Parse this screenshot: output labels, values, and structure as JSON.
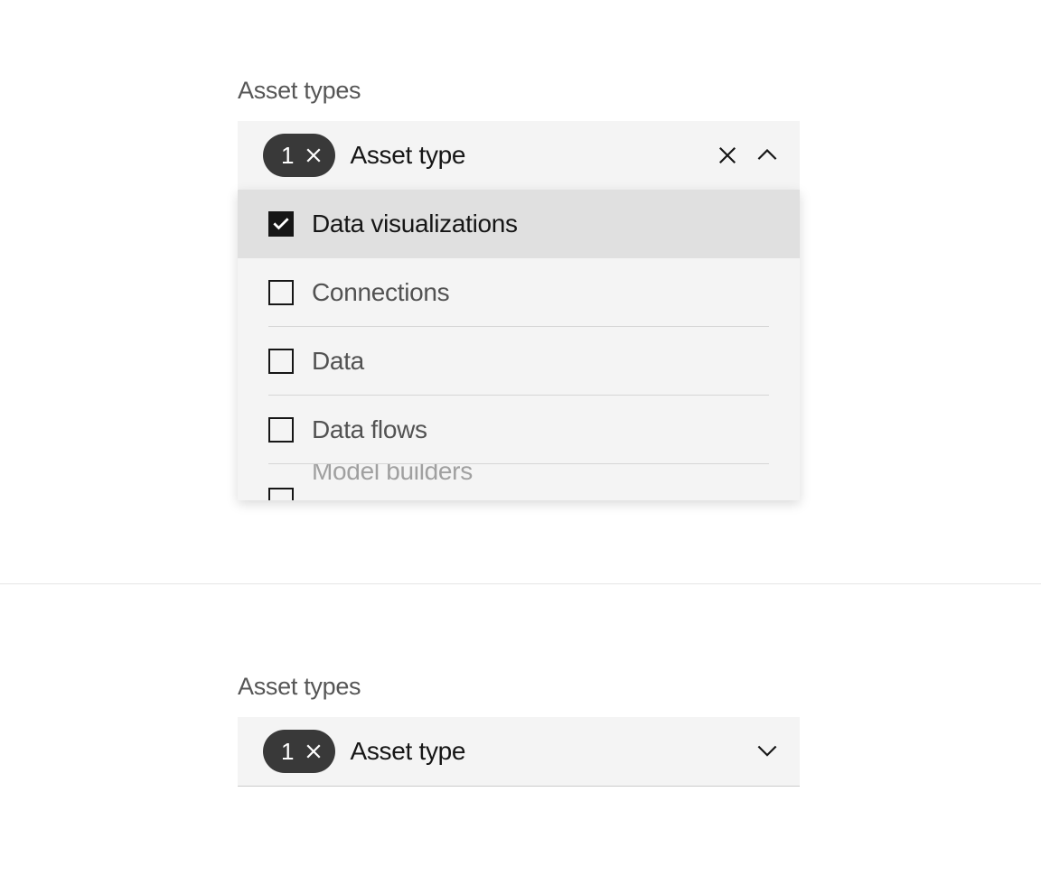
{
  "open_select": {
    "field_label": "Asset types",
    "count": "1",
    "title": "Asset type",
    "options": [
      {
        "label": "Data visualizations",
        "checked": true
      },
      {
        "label": "Connections",
        "checked": false
      },
      {
        "label": "Data",
        "checked": false
      },
      {
        "label": "Data flows",
        "checked": false
      }
    ],
    "partial_option": {
      "label": "Model builders"
    }
  },
  "closed_select": {
    "field_label": "Asset types",
    "count": "1",
    "title": "Asset type"
  }
}
